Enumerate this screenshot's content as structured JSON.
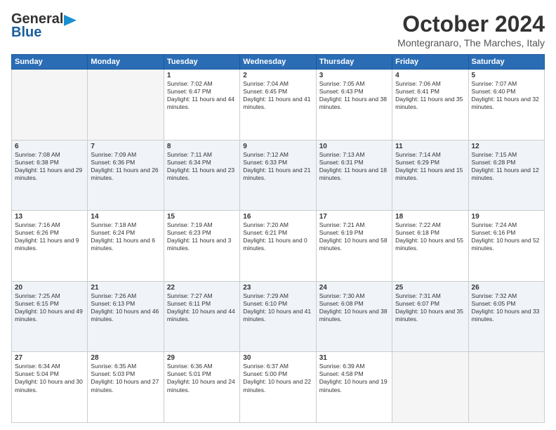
{
  "header": {
    "logo_line1": "General",
    "logo_line2": "Blue",
    "title": "October 2024",
    "subtitle": "Montegranaro, The Marches, Italy"
  },
  "days_of_week": [
    "Sunday",
    "Monday",
    "Tuesday",
    "Wednesday",
    "Thursday",
    "Friday",
    "Saturday"
  ],
  "weeks": [
    [
      {
        "day": "",
        "info": ""
      },
      {
        "day": "",
        "info": ""
      },
      {
        "day": "1",
        "info": "Sunrise: 7:02 AM\nSunset: 6:47 PM\nDaylight: 11 hours and 44 minutes."
      },
      {
        "day": "2",
        "info": "Sunrise: 7:04 AM\nSunset: 6:45 PM\nDaylight: 11 hours and 41 minutes."
      },
      {
        "day": "3",
        "info": "Sunrise: 7:05 AM\nSunset: 6:43 PM\nDaylight: 11 hours and 38 minutes."
      },
      {
        "day": "4",
        "info": "Sunrise: 7:06 AM\nSunset: 6:41 PM\nDaylight: 11 hours and 35 minutes."
      },
      {
        "day": "5",
        "info": "Sunrise: 7:07 AM\nSunset: 6:40 PM\nDaylight: 11 hours and 32 minutes."
      }
    ],
    [
      {
        "day": "6",
        "info": "Sunrise: 7:08 AM\nSunset: 6:38 PM\nDaylight: 11 hours and 29 minutes."
      },
      {
        "day": "7",
        "info": "Sunrise: 7:09 AM\nSunset: 6:36 PM\nDaylight: 11 hours and 26 minutes."
      },
      {
        "day": "8",
        "info": "Sunrise: 7:11 AM\nSunset: 6:34 PM\nDaylight: 11 hours and 23 minutes."
      },
      {
        "day": "9",
        "info": "Sunrise: 7:12 AM\nSunset: 6:33 PM\nDaylight: 11 hours and 21 minutes."
      },
      {
        "day": "10",
        "info": "Sunrise: 7:13 AM\nSunset: 6:31 PM\nDaylight: 11 hours and 18 minutes."
      },
      {
        "day": "11",
        "info": "Sunrise: 7:14 AM\nSunset: 6:29 PM\nDaylight: 11 hours and 15 minutes."
      },
      {
        "day": "12",
        "info": "Sunrise: 7:15 AM\nSunset: 6:28 PM\nDaylight: 11 hours and 12 minutes."
      }
    ],
    [
      {
        "day": "13",
        "info": "Sunrise: 7:16 AM\nSunset: 6:26 PM\nDaylight: 11 hours and 9 minutes."
      },
      {
        "day": "14",
        "info": "Sunrise: 7:18 AM\nSunset: 6:24 PM\nDaylight: 11 hours and 6 minutes."
      },
      {
        "day": "15",
        "info": "Sunrise: 7:19 AM\nSunset: 6:23 PM\nDaylight: 11 hours and 3 minutes."
      },
      {
        "day": "16",
        "info": "Sunrise: 7:20 AM\nSunset: 6:21 PM\nDaylight: 11 hours and 0 minutes."
      },
      {
        "day": "17",
        "info": "Sunrise: 7:21 AM\nSunset: 6:19 PM\nDaylight: 10 hours and 58 minutes."
      },
      {
        "day": "18",
        "info": "Sunrise: 7:22 AM\nSunset: 6:18 PM\nDaylight: 10 hours and 55 minutes."
      },
      {
        "day": "19",
        "info": "Sunrise: 7:24 AM\nSunset: 6:16 PM\nDaylight: 10 hours and 52 minutes."
      }
    ],
    [
      {
        "day": "20",
        "info": "Sunrise: 7:25 AM\nSunset: 6:15 PM\nDaylight: 10 hours and 49 minutes."
      },
      {
        "day": "21",
        "info": "Sunrise: 7:26 AM\nSunset: 6:13 PM\nDaylight: 10 hours and 46 minutes."
      },
      {
        "day": "22",
        "info": "Sunrise: 7:27 AM\nSunset: 6:11 PM\nDaylight: 10 hours and 44 minutes."
      },
      {
        "day": "23",
        "info": "Sunrise: 7:29 AM\nSunset: 6:10 PM\nDaylight: 10 hours and 41 minutes."
      },
      {
        "day": "24",
        "info": "Sunrise: 7:30 AM\nSunset: 6:08 PM\nDaylight: 10 hours and 38 minutes."
      },
      {
        "day": "25",
        "info": "Sunrise: 7:31 AM\nSunset: 6:07 PM\nDaylight: 10 hours and 35 minutes."
      },
      {
        "day": "26",
        "info": "Sunrise: 7:32 AM\nSunset: 6:05 PM\nDaylight: 10 hours and 33 minutes."
      }
    ],
    [
      {
        "day": "27",
        "info": "Sunrise: 6:34 AM\nSunset: 5:04 PM\nDaylight: 10 hours and 30 minutes."
      },
      {
        "day": "28",
        "info": "Sunrise: 6:35 AM\nSunset: 5:03 PM\nDaylight: 10 hours and 27 minutes."
      },
      {
        "day": "29",
        "info": "Sunrise: 6:36 AM\nSunset: 5:01 PM\nDaylight: 10 hours and 24 minutes."
      },
      {
        "day": "30",
        "info": "Sunrise: 6:37 AM\nSunset: 5:00 PM\nDaylight: 10 hours and 22 minutes."
      },
      {
        "day": "31",
        "info": "Sunrise: 6:39 AM\nSunset: 4:58 PM\nDaylight: 10 hours and 19 minutes."
      },
      {
        "day": "",
        "info": ""
      },
      {
        "day": "",
        "info": ""
      }
    ]
  ]
}
